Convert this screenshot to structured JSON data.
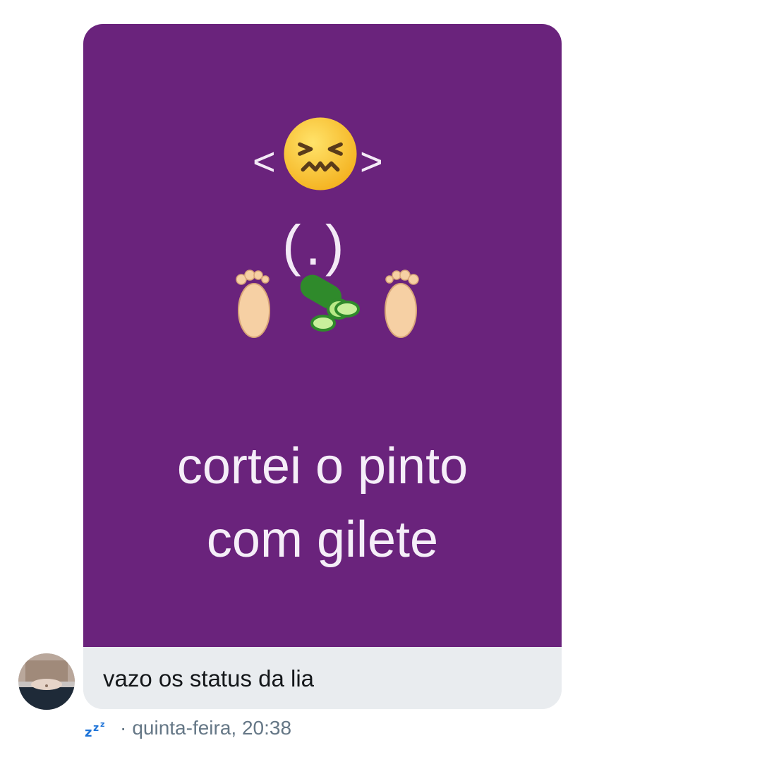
{
  "media": {
    "bracket_left": "<",
    "bracket_right": ">",
    "parens": "(.)",
    "caption_line_1": "cortei o pinto",
    "caption_line_2": "com gilete",
    "icons": [
      "confounded-face-emoji",
      "foot-emoji",
      "cucumber-emoji",
      "foot-emoji"
    ],
    "background_color": "#6a237c"
  },
  "message": {
    "text": "vazo os status da lia",
    "bubble_color": "#e9ecef"
  },
  "meta": {
    "status_icon": "zzz-icon",
    "separator": "·",
    "timestamp": "quinta-feira, 20:38"
  }
}
